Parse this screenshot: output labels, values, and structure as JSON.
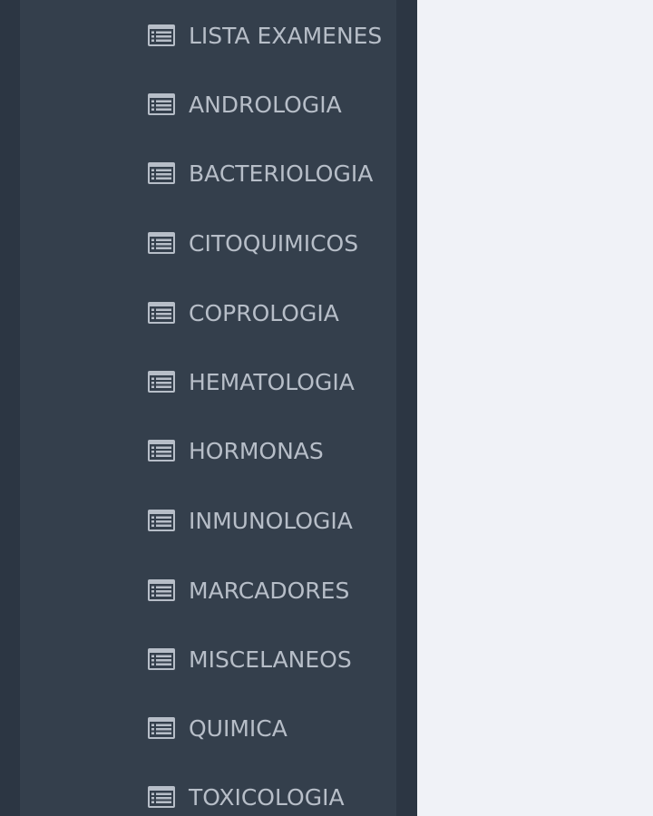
{
  "sidebar": {
    "items": [
      {
        "label": "LISTA EXAMENES",
        "icon": "list-alt-icon"
      },
      {
        "label": "ANDROLOGIA",
        "icon": "list-alt-icon"
      },
      {
        "label": "BACTERIOLOGIA",
        "icon": "list-alt-icon"
      },
      {
        "label": "CITOQUIMICOS",
        "icon": "list-alt-icon"
      },
      {
        "label": "COPROLOGIA",
        "icon": "list-alt-icon"
      },
      {
        "label": "HEMATOLOGIA",
        "icon": "list-alt-icon"
      },
      {
        "label": "HORMONAS",
        "icon": "list-alt-icon"
      },
      {
        "label": "INMUNOLOGIA",
        "icon": "list-alt-icon"
      },
      {
        "label": "MARCADORES",
        "icon": "list-alt-icon"
      },
      {
        "label": "MISCELANEOS",
        "icon": "list-alt-icon"
      },
      {
        "label": "QUIMICA",
        "icon": "list-alt-icon"
      },
      {
        "label": "TOXICOLOGIA",
        "icon": "list-alt-icon"
      }
    ]
  },
  "colors": {
    "sidebar_outer": "#2c3643",
    "sidebar_inner": "#343f4c",
    "content_bg": "#f0f2f7",
    "item_text": "#b7bec8",
    "icon_color": "#b7bec8"
  }
}
